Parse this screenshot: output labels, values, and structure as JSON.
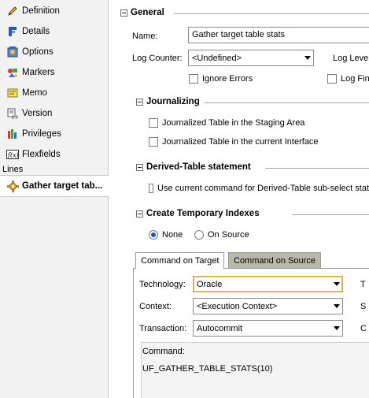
{
  "nav": {
    "items": [
      {
        "label": "Definition",
        "icon": "pencil-icon"
      },
      {
        "label": "Details",
        "icon": "details-icon"
      },
      {
        "label": "Options",
        "icon": "options-icon"
      },
      {
        "label": "Markers",
        "icon": "markers-icon"
      },
      {
        "label": "Memo",
        "icon": "memo-icon"
      },
      {
        "label": "Version",
        "icon": "version-icon"
      },
      {
        "label": "Privileges",
        "icon": "privileges-icon"
      },
      {
        "label": "Flexfields",
        "icon": "flexfields-icon"
      }
    ],
    "lines_label": "Lines",
    "active_item": {
      "label": "Gather target tab...",
      "icon": "gear-icon"
    }
  },
  "general": {
    "title": "General",
    "name_label": "Name:",
    "name_value": "Gather target table stats",
    "log_counter_label": "Log Counter:",
    "log_counter_value": "<Undefined>",
    "log_level_label": "Log Level",
    "ignore_errors_label": "Ignore Errors",
    "log_final_label": "Log Fina"
  },
  "journalizing": {
    "title": "Journalizing",
    "opt1": "Journalized Table in the Staging Area",
    "opt2": "Journalized Table in the current Interface"
  },
  "derived": {
    "title": "Derived-Table statement",
    "opt1": "Use current command for Derived-Table sub-select stat"
  },
  "temp_indexes": {
    "title": "Create Temporary Indexes",
    "radio_none": "None",
    "radio_on_source": "On Source",
    "selected": "None"
  },
  "tabs": {
    "target": "Command on Target",
    "source": "Command on Source",
    "active": "Command on Target"
  },
  "command": {
    "technology_label": "Technology:",
    "technology_value": "Oracle",
    "context_label": "Context:",
    "context_value": "<Execution Context>",
    "transaction_label": "Transaction:",
    "transaction_value": "Autocommit",
    "right_label_1": "T",
    "right_label_2": "S",
    "right_label_3": "C",
    "command_label": "Command:",
    "command_text": "UF_GATHER_TABLE_STATS(10)"
  },
  "colors": {
    "active_field_border": "#e0a040",
    "inactive_tab": "#b9b9a9",
    "radio_selected": "#1a56c4"
  }
}
